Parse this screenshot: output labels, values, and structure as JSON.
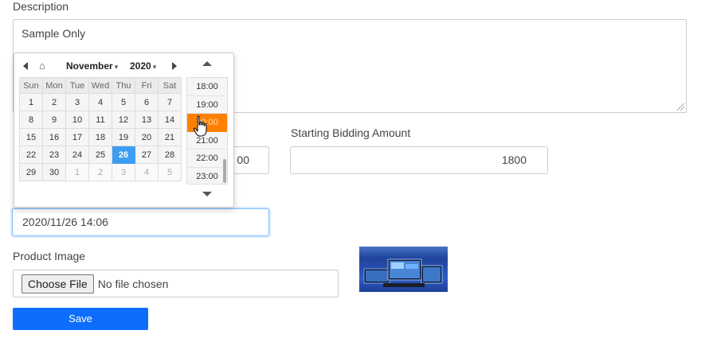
{
  "form": {
    "description_label": "Description",
    "description_value": "Sample Only",
    "starting_bid_label": "Starting Bidding Amount",
    "starting_bid_value": "1800",
    "hidden_field_partial": "00",
    "datetime_value": "2020/11/26 14:06",
    "product_image_label": "Product Image",
    "choose_file_label": "Choose File",
    "no_file_text": "No file chosen",
    "save_label": "Save"
  },
  "picker": {
    "month": "November",
    "year": "2020",
    "weekdays": [
      "Sun",
      "Mon",
      "Tue",
      "Wed",
      "Thu",
      "Fri",
      "Sat"
    ],
    "weeks": [
      [
        "1",
        "2",
        "3",
        "4",
        "5",
        "6",
        "7"
      ],
      [
        "8",
        "9",
        "10",
        "11",
        "12",
        "13",
        "14"
      ],
      [
        "15",
        "16",
        "17",
        "18",
        "19",
        "20",
        "21"
      ],
      [
        "22",
        "23",
        "24",
        "25",
        "26",
        "27",
        "28"
      ],
      [
        "29",
        "30",
        "1",
        "2",
        "3",
        "4",
        "5"
      ]
    ],
    "selected_day": "26",
    "times": [
      "18:00",
      "19:00",
      "20:00",
      "21:00",
      "22:00",
      "23:00"
    ],
    "active_time": "20:00",
    "colors": {
      "selected_day": "#3d9df0",
      "active_time": "#ff8000"
    },
    "icons": [
      "prev-month-icon",
      "home-icon",
      "next-month-icon",
      "time-up-icon",
      "time-down-icon"
    ]
  }
}
